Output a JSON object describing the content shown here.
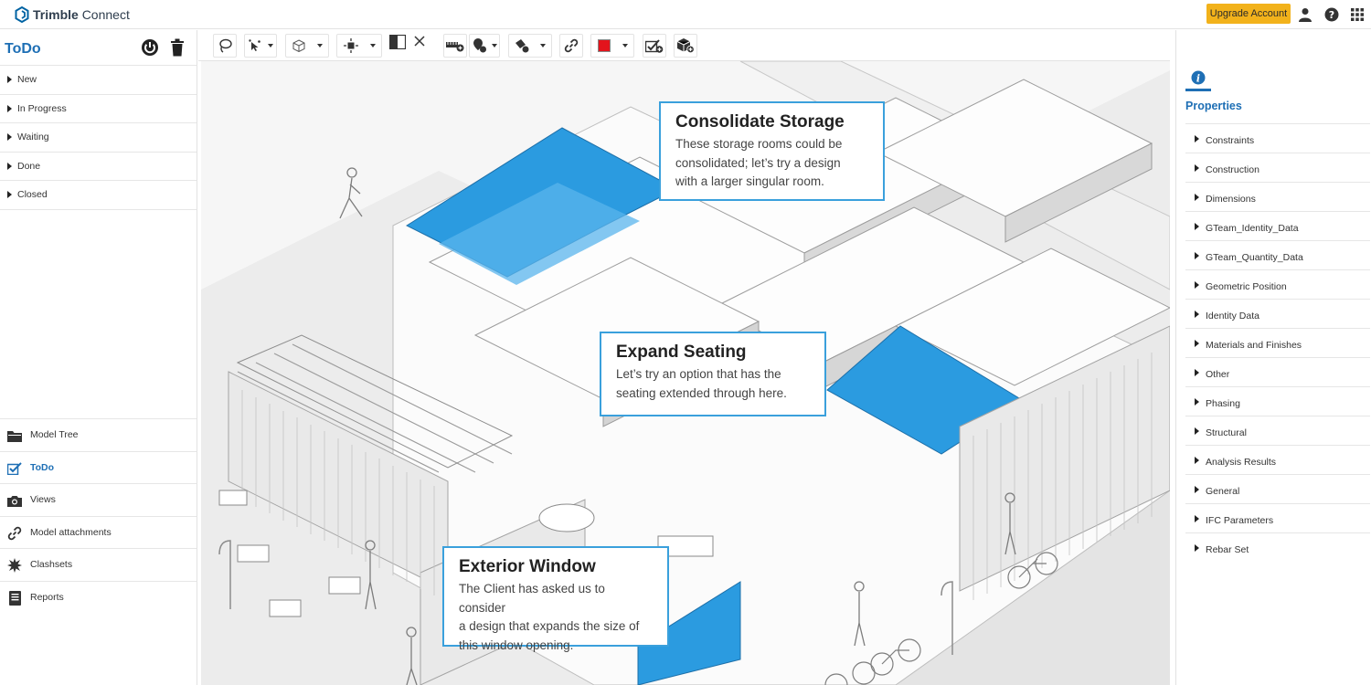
{
  "app": {
    "brand_prefix": "Trimble",
    "brand_suffix": "Connect",
    "upgrade_label": "Upgrade Account",
    "icons": [
      "user-icon",
      "help-icon",
      "apps-grid-icon"
    ]
  },
  "left_panel": {
    "title": "ToDo",
    "statuses": [
      {
        "label": "New"
      },
      {
        "label": "In Progress"
      },
      {
        "label": "Waiting"
      },
      {
        "label": "Done"
      },
      {
        "label": "Closed"
      }
    ],
    "nav": [
      {
        "label": "Model Tree",
        "icon": "folder-icon",
        "active": false
      },
      {
        "label": "ToDo",
        "icon": "todo-check-icon",
        "active": true
      },
      {
        "label": "Views",
        "icon": "camera-icon",
        "active": false
      },
      {
        "label": "Model attachments",
        "icon": "link-icon",
        "active": false
      },
      {
        "label": "Clashsets",
        "icon": "clash-icon",
        "active": false
      },
      {
        "label": "Reports",
        "icon": "report-icon",
        "active": false
      }
    ]
  },
  "toolbar": {
    "tools": [
      "lasso-select-icon",
      "selection-mode-icon",
      "view-cube-icon",
      "section-center-icon",
      "split-view-icon",
      "close-x-icon",
      "measure-icon",
      "markup-icon",
      "paint-bucket-icon",
      "link-icon",
      "color-swatch-icon",
      "check-add-icon",
      "object-icon"
    ],
    "accent_color": "#e3141c"
  },
  "viewport": {
    "callouts": [
      {
        "title": "Consolidate Storage",
        "lines": [
          "These storage rooms could be",
          "consolidated; let’s try a design",
          "with a larger singular room."
        ]
      },
      {
        "title": "Expand Seating",
        "lines": [
          "Let’s try an option that has the",
          "seating extended through here."
        ]
      },
      {
        "title": "Exterior Window",
        "lines": [
          "The Client has asked us to consider",
          "a design that expands the size of",
          "this window opening."
        ]
      }
    ],
    "highlight_color": "#2b9be0"
  },
  "right_panel": {
    "tab_icon": "info-icon",
    "title": "Properties",
    "items": [
      {
        "label": "Constraints"
      },
      {
        "label": "Construction"
      },
      {
        "label": "Dimensions"
      },
      {
        "label": "GTeam_Identity_Data"
      },
      {
        "label": "GTeam_Quantity_Data"
      },
      {
        "label": "Geometric Position"
      },
      {
        "label": "Identity Data"
      },
      {
        "label": "Materials and Finishes"
      },
      {
        "label": "Other"
      },
      {
        "label": "Phasing"
      },
      {
        "label": "Structural"
      },
      {
        "label": "Analysis Results"
      },
      {
        "label": "General"
      },
      {
        "label": "IFC Parameters"
      },
      {
        "label": "Rebar Set"
      }
    ]
  }
}
